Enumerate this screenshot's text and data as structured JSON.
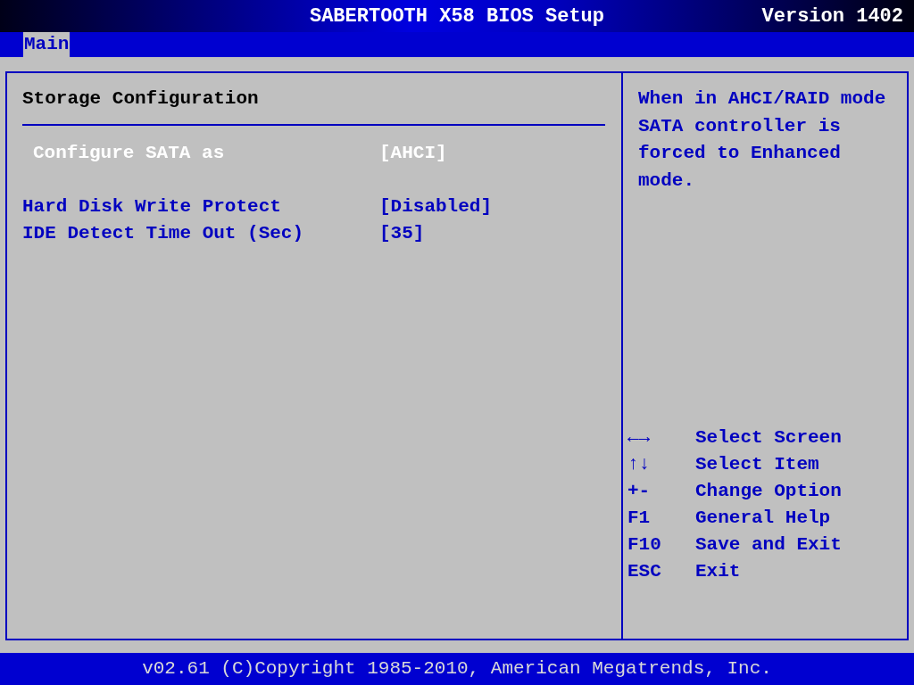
{
  "header": {
    "title": "SABERTOOTH X58 BIOS Setup",
    "version": "Version 1402"
  },
  "tabs": [
    {
      "label": "Main",
      "selected": true
    }
  ],
  "section_title": "Storage Configuration",
  "settings": [
    {
      "label": "Configure SATA as",
      "value": "[AHCI]",
      "selected": true
    },
    {
      "label": "Hard Disk Write Protect",
      "value": "[Disabled]",
      "selected": false
    },
    {
      "label": "IDE Detect Time Out (Sec)",
      "value": "[35]",
      "selected": false
    }
  ],
  "help_lines": [
    "When in AHCI/RAID mode",
    "SATA controller is",
    "forced to Enhanced",
    "mode."
  ],
  "keys": [
    {
      "key": "←→",
      "action": "Select Screen"
    },
    {
      "key": "↑↓",
      "action": "Select Item"
    },
    {
      "key": "+-",
      "action": "Change Option"
    },
    {
      "key": "F1",
      "action": "General Help"
    },
    {
      "key": "F10",
      "action": "Save and Exit"
    },
    {
      "key": "ESC",
      "action": "Exit"
    }
  ],
  "footer": "v02.61 (C)Copyright 1985-2010, American Megatrends, Inc."
}
